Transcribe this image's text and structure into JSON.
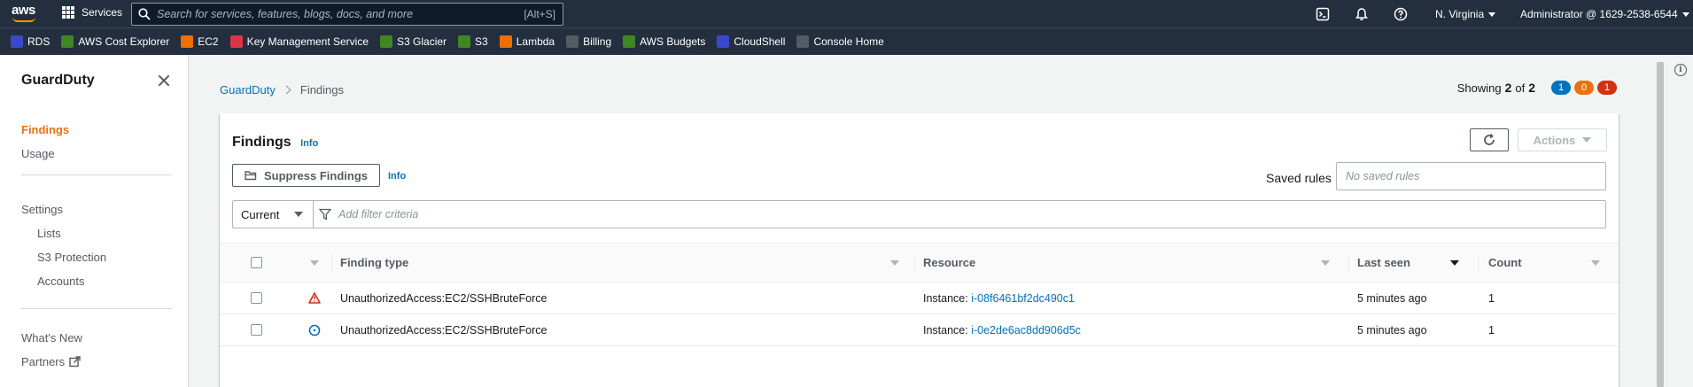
{
  "topnav": {
    "logo_text": "aws",
    "services_label": "Services",
    "search_placeholder": "Search for services, features, blogs, docs, and more",
    "search_shortcut": "[Alt+S]",
    "region": "N. Virginia",
    "account": "Administrator @ 1629-2538-6544"
  },
  "favorites": [
    {
      "label": "RDS",
      "color": "#3b48cc"
    },
    {
      "label": "AWS Cost Explorer",
      "color": "#3f8624"
    },
    {
      "label": "EC2",
      "color": "#ed7100"
    },
    {
      "label": "Key Management Service",
      "color": "#dd344c"
    },
    {
      "label": "S3 Glacier",
      "color": "#3f8624"
    },
    {
      "label": "S3",
      "color": "#3f8624"
    },
    {
      "label": "Lambda",
      "color": "#ed7100"
    },
    {
      "label": "Billing",
      "color": "#545b64"
    },
    {
      "label": "AWS Budgets",
      "color": "#3f8624"
    },
    {
      "label": "CloudShell",
      "color": "#3b48cc"
    },
    {
      "label": "Console Home",
      "color": "#545b64"
    }
  ],
  "sidebar": {
    "title": "GuardDuty",
    "items": [
      {
        "label": "Findings"
      },
      {
        "label": "Usage"
      },
      {
        "label": "Settings"
      },
      {
        "label": "Lists"
      },
      {
        "label": "S3 Protection"
      },
      {
        "label": "Accounts"
      },
      {
        "label": "What's New"
      },
      {
        "label": "Partners"
      }
    ]
  },
  "breadcrumb": {
    "root": "GuardDuty",
    "current": "Findings"
  },
  "showing": {
    "prefix": "Showing",
    "count": "2",
    "of": "of",
    "total": "2",
    "low": "1",
    "medium": "0",
    "high": "1"
  },
  "panel": {
    "title": "Findings",
    "info": "Info",
    "suppress_label": "Suppress Findings",
    "suppress_info": "Info",
    "actions_label": "Actions",
    "saved_rules_label": "Saved rules",
    "saved_rules_placeholder": "No saved rules",
    "filter_select": "Current",
    "filter_placeholder": "Add filter criteria"
  },
  "table": {
    "headers": {
      "finding_type": "Finding type",
      "resource": "Resource",
      "last_seen": "Last seen",
      "count": "Count"
    },
    "rows": [
      {
        "severity": "high",
        "finding_type": "UnauthorizedAccess:EC2/SSHBruteForce",
        "resource_prefix": "Instance: ",
        "resource_id": "i-08f6461bf2dc490c1",
        "last_seen": "5 minutes ago",
        "count": "1"
      },
      {
        "severity": "low",
        "finding_type": "UnauthorizedAccess:EC2/SSHBruteForce",
        "resource_prefix": "Instance: ",
        "resource_id": "i-0e2de6ac8dd906d5c",
        "last_seen": "5 minutes ago",
        "count": "1"
      }
    ]
  },
  "colors": {
    "accent": "#ec7211",
    "link": "#0073bb",
    "severity_low": "#0073bb",
    "severity_medium": "#ec7211",
    "severity_high": "#d13212"
  }
}
